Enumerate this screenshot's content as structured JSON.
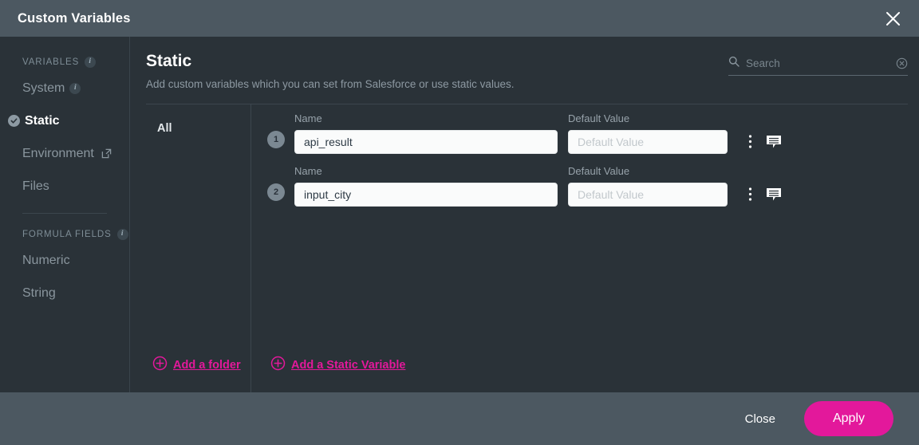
{
  "window": {
    "title": "Custom Variables",
    "close_icon": "close-icon"
  },
  "sidebar": {
    "sections": [
      {
        "label": "VARIABLES",
        "has_info": true,
        "items": [
          {
            "label": "System",
            "has_info": true,
            "active": false,
            "external": false
          },
          {
            "label": "Static",
            "has_info": false,
            "active": true,
            "external": false
          },
          {
            "label": "Environment",
            "has_info": false,
            "active": false,
            "external": true
          },
          {
            "label": "Files",
            "has_info": false,
            "active": false,
            "external": false
          }
        ]
      },
      {
        "label": "FORMULA FIELDS",
        "has_info": true,
        "items": [
          {
            "label": "Numeric",
            "has_info": false,
            "active": false,
            "external": false
          },
          {
            "label": "String",
            "has_info": false,
            "active": false,
            "external": false
          }
        ]
      }
    ]
  },
  "main": {
    "title": "Static",
    "subtitle": "Add custom variables which you can set from Salesforce or use static values."
  },
  "search": {
    "placeholder": "Search",
    "value": "",
    "icon": "search-icon",
    "clear_icon": "clear-circle-icon"
  },
  "folders": {
    "items": [
      {
        "label": "All",
        "selected": true
      }
    ],
    "add_folder_label": "Add a folder"
  },
  "variables": {
    "name_label": "Name",
    "default_label": "Default Value",
    "default_placeholder": "Default Value",
    "add_variable_label": "Add a Static Variable",
    "rows": [
      {
        "index": "1",
        "name": "api_result",
        "default_value": ""
      },
      {
        "index": "2",
        "name": "input_city",
        "default_value": ""
      }
    ]
  },
  "footer": {
    "close_label": "Close",
    "apply_label": "Apply"
  },
  "colors": {
    "accent_pink": "#e3189b",
    "chrome_slate": "#4c5861",
    "panel_dark": "#2a3238"
  }
}
